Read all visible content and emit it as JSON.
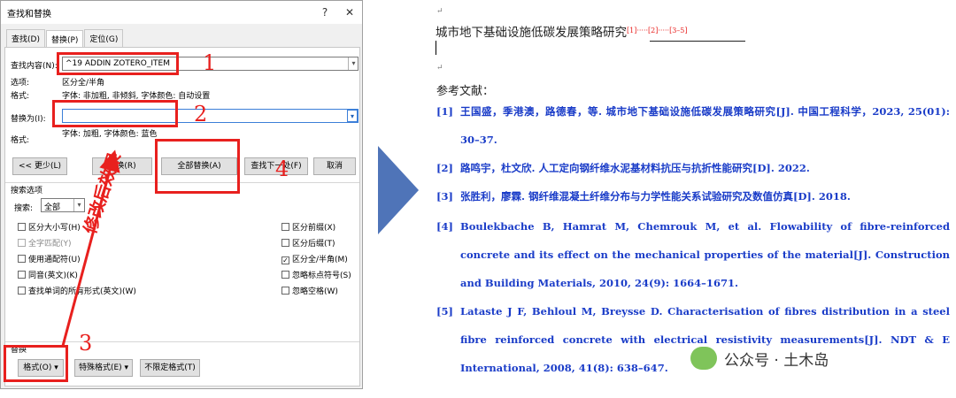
{
  "dialog": {
    "title": "查找和替换",
    "help": "?",
    "close": "✕",
    "tabs": [
      "查找(D)",
      "替换(P)",
      "定位(G)"
    ],
    "find_label": "查找内容(N):",
    "find_value": "^19 ADDIN ZOTERO_ITEM",
    "options_label": "选项:",
    "options_value": "区分全/半角",
    "format1_label": "格式:",
    "format1_value": "字体: 非加粗, 非倾斜, 字体颜色: 自动设置",
    "replace_label": "替换为(I):",
    "replace_value": "",
    "format2_label": "格式:",
    "format2_value": "字体: 加粗, 字体颜色: 蓝色",
    "buttons": {
      "less": "<< 更少(L)",
      "replace": "替换(R)",
      "replace_all": "全部替换(A)",
      "find_next": "查找下一处(F)",
      "cancel": "取消"
    },
    "search_options_label": "搜索选项",
    "search_label": "搜索:",
    "search_value": "全部",
    "checks_left": [
      {
        "label": "区分大小写(H)",
        "checked": false,
        "disabled": false
      },
      {
        "label": "全字匹配(Y)",
        "checked": false,
        "disabled": true
      },
      {
        "label": "使用通配符(U)",
        "checked": false,
        "disabled": false
      },
      {
        "label": "同音(英文)(K)",
        "checked": false,
        "disabled": false
      },
      {
        "label": "查找单词的所有形式(英文)(W)",
        "checked": false,
        "disabled": false
      }
    ],
    "checks_right": [
      {
        "label": "区分前缀(X)",
        "checked": false
      },
      {
        "label": "区分后缀(T)",
        "checked": false
      },
      {
        "label": "区分全/半角(M)",
        "checked": true
      },
      {
        "label": "忽略标点符号(S)",
        "checked": false
      },
      {
        "label": "忽略空格(W)",
        "checked": false
      }
    ],
    "replace_section_label": "替换",
    "bottom_buttons": {
      "format": "格式(O) ▾",
      "special": "特殊格式(E) ▾",
      "no_format": "不限定格式(T)"
    }
  },
  "annotations": {
    "n1": "1",
    "n2": "2",
    "n3": "3",
    "n4": "4",
    "note": "修改后效果",
    "color": "#e8201e"
  },
  "arrow_color": "#4f74b8",
  "document": {
    "title_text": "城市地下基础设施低碳发展策略研究",
    "cites": "[1]·····[2]·····[3–5]",
    "refs_heading": "参考文献：",
    "refs": [
      {
        "num": "[1]",
        "text": "王国盛，季港澳，路德春，等. 城市地下基础设施低碳发展策略研究[J]. 中国工程科学，2023, 25(01): 30–37."
      },
      {
        "num": "[2]",
        "text": "路鸣宇，杜文欣. 人工定向钢纤维水泥基材料抗压与抗折性能研究[D]. 2022."
      },
      {
        "num": "[3]",
        "text": "张胜利，廖霖. 钢纤维混凝土纤维分布与力学性能关系试验研究及数值仿真[D]. 2018."
      },
      {
        "num": "[4]",
        "text": "Boulekbache B, Hamrat M, Chemrouk M, et al. Flowability of fibre-reinforced concrete and its effect on the mechanical properties of the material[J]. Construction and Building Materials, 2010, 24(9): 1664–1671."
      },
      {
        "num": "[5]",
        "text": "Lataste J F, Behloul M, Breysse D. Characterisation of fibres distribution in a steel fibre reinforced concrete with electrical resistivity measurements[J]. NDT & E International, 2008, 41(8): 638–647."
      }
    ],
    "ref_color": "#1a3cc8"
  },
  "watermark": "公众号 · 土木岛"
}
